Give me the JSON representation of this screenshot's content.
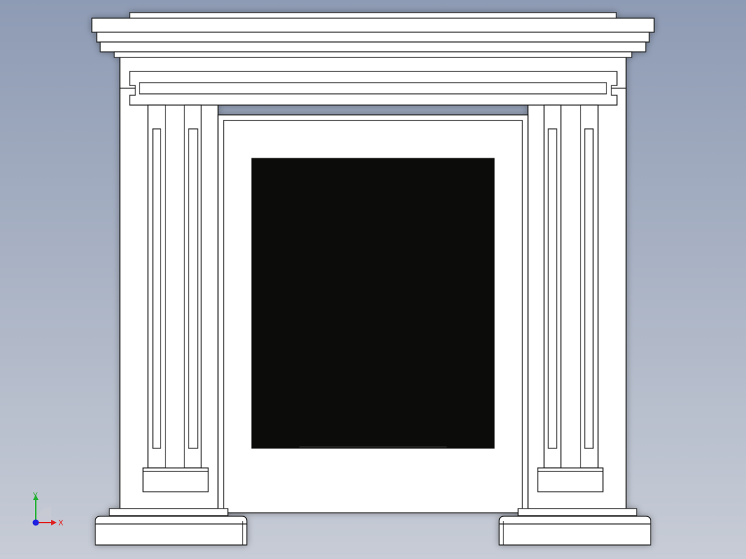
{
  "viewport": {
    "background_top": "#8e9bb4",
    "background_bottom": "#c7ccd6",
    "model_fill": "#ffffff",
    "model_edge": "#1a1a1a",
    "opening_fill": "#0c0d0b"
  },
  "triad": {
    "x_label": "X",
    "y_label": "Y",
    "x_color": "#e02020",
    "y_color": "#20b030",
    "z_color": "#2020e0"
  }
}
